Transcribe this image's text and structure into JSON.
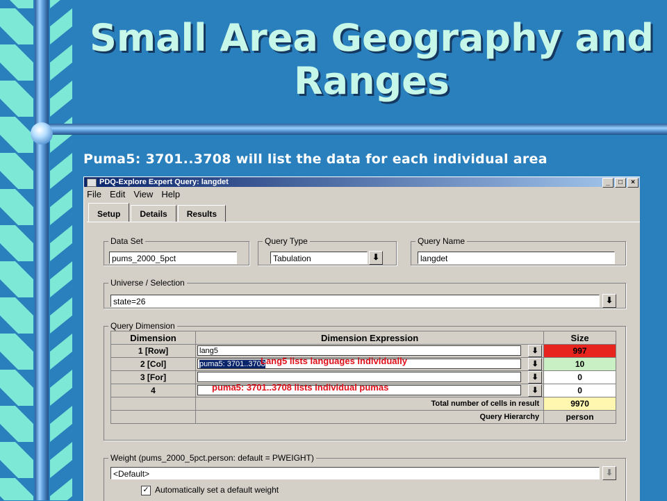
{
  "slide": {
    "title": "Small Area Geography and Ranges",
    "subtitle": "Puma5: 3701..3708 will list the data for each individual area"
  },
  "window": {
    "title": "PDQ-Explore Expert Query: langdet",
    "menu": [
      "File",
      "Edit",
      "View",
      "Help"
    ],
    "tabs": [
      "Setup",
      "Details",
      "Results"
    ],
    "active_tab": "Setup"
  },
  "setup": {
    "data_set_label": "Data Set",
    "data_set_value": "pums_2000_5pct",
    "query_type_label": "Query Type",
    "query_type_value": "Tabulation",
    "query_name_label": "Query Name",
    "query_name_value": "langdet",
    "universe_label": "Universe / Selection",
    "universe_value": "state=26",
    "query_dimension_label": "Query Dimension",
    "columns": [
      "Dimension",
      "Dimension Expression",
      "Size"
    ],
    "rows": [
      {
        "dimension": "1 [Row]",
        "expression": "lang5",
        "size": "997",
        "size_color": "#e8241e"
      },
      {
        "dimension": "2 [Col]",
        "expression": "puma5: 3701..3708",
        "size": "10",
        "size_color": "#c9f0c4"
      },
      {
        "dimension": "3 [For]",
        "expression": "",
        "size": "0",
        "size_color": "#ffffff"
      },
      {
        "dimension": "4",
        "expression": "",
        "size": "0",
        "size_color": "#ffffff"
      }
    ],
    "total_label": "Total number of cells in result",
    "total_value": "9970",
    "hierarchy_label": "Query Hierarchy",
    "hierarchy_value": "person",
    "weight_label": "Weight (pums_2000_5pct.person: default = PWEIGHT)",
    "weight_value": "<Default>",
    "auto_weight_label": "Automatically set a default weight",
    "auto_weight_checked": "✓"
  },
  "annotations": {
    "lang_note": "Lang5 lists languages individually",
    "puma_note": "puma5: 3701..3708 lists individual pumas"
  },
  "colors": {
    "background": "#2a7fbd",
    "stripe_light": "#7de8d5",
    "title_color": "#c6f7e8",
    "note_red": "#e0101a"
  }
}
